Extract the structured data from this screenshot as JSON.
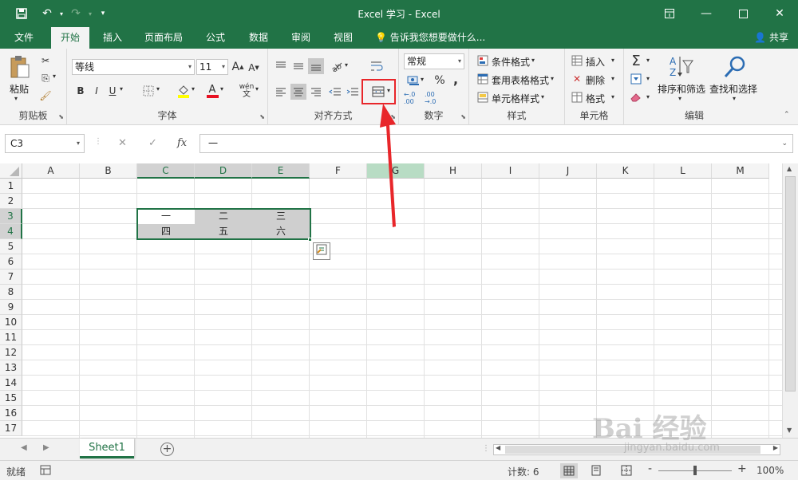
{
  "app": {
    "title": "Excel 学习  -  Excel"
  },
  "quick_access": {
    "save": "save-icon",
    "undo": "undo-icon",
    "redo": "redo-icon",
    "customize": "customize-icon"
  },
  "window_controls": {
    "ribbon_display": "ribbon-display-icon",
    "minimize": "minimize-icon",
    "maximize": "maximize-icon",
    "close": "close-icon"
  },
  "tabs": [
    {
      "label": "文件"
    },
    {
      "label": "开始"
    },
    {
      "label": "插入"
    },
    {
      "label": "页面布局"
    },
    {
      "label": "公式"
    },
    {
      "label": "数据"
    },
    {
      "label": "审阅"
    },
    {
      "label": "视图"
    }
  ],
  "active_tab": "开始",
  "tell_me": "告诉我您想要做什么...",
  "share": "共享",
  "ribbon": {
    "clipboard": {
      "label": "剪贴板",
      "paste": "粘贴"
    },
    "font": {
      "label": "字体",
      "font_name": "等线",
      "font_size": "11",
      "bold": "B",
      "italic": "I",
      "underline": "U",
      "grow": "A",
      "shrink": "A",
      "font_color": "A",
      "phonetic": "wén"
    },
    "alignment": {
      "label": "对齐方式"
    },
    "number": {
      "label": "数字",
      "format": "常规",
      "percent": "%",
      "comma": ",",
      "inc_decimal": "←.0 .00",
      "dec_decimal": ".00 →.0"
    },
    "styles": {
      "label": "样式",
      "conditional": "条件格式",
      "table": "套用表格格式",
      "cell_styles": "单元格样式"
    },
    "cells": {
      "label": "单元格",
      "insert": "插入",
      "delete": "删除",
      "format": "格式"
    },
    "editing": {
      "label": "编辑",
      "sort_filter": "排序和筛选",
      "find_select": "查找和选择",
      "sum": "Σ"
    }
  },
  "formula_bar": {
    "name_box": "C3",
    "cancel": "✕",
    "enter": "✓",
    "fx": "fx",
    "content": "一"
  },
  "columns": [
    "A",
    "B",
    "C",
    "D",
    "E",
    "F",
    "G",
    "H",
    "I",
    "J",
    "K",
    "L",
    "M"
  ],
  "rows": [
    "1",
    "2",
    "3",
    "4",
    "5",
    "6",
    "7",
    "8",
    "9",
    "10",
    "11",
    "12",
    "13",
    "14",
    "15",
    "16",
    "17"
  ],
  "cells": {
    "C3": "一",
    "D3": "二",
    "E3": "三",
    "C4": "四",
    "D4": "五",
    "E4": "六"
  },
  "sheets": [
    {
      "name": "Sheet1"
    }
  ],
  "add_sheet": "+",
  "status": {
    "ready": "就绪",
    "count_label": "计数: 6",
    "zoom": "100%",
    "zoom_minus": "-",
    "zoom_plus": "+"
  },
  "watermark": {
    "main": "Bai 经验",
    "sub": "jingyan.baidu.com"
  },
  "colors": {
    "excel_green": "#217346",
    "highlight_red": "#e8262a",
    "shaded_cell": "#cfcfcf"
  }
}
